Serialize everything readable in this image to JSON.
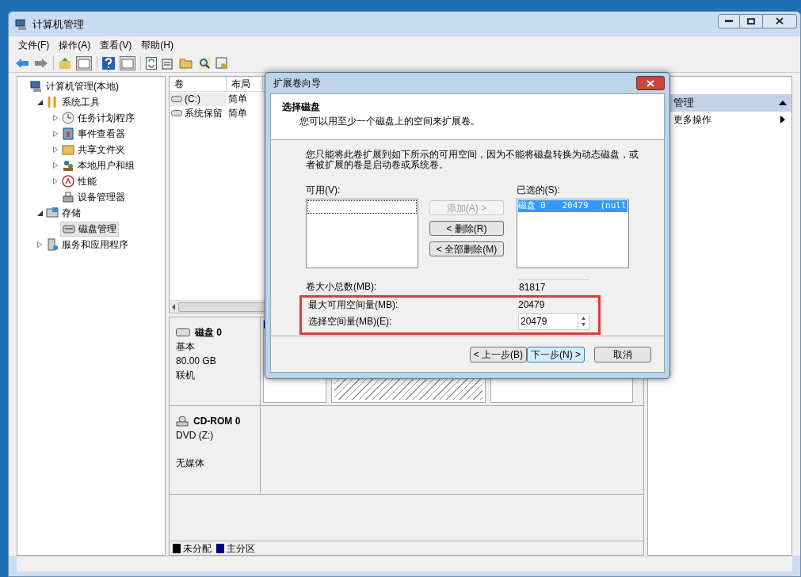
{
  "window": {
    "title": "计算机管理"
  },
  "menu": [
    {
      "label": "文件(F)"
    },
    {
      "label": "操作(A)"
    },
    {
      "label": "查看(V)"
    },
    {
      "label": "帮助(H)"
    }
  ],
  "tree": [
    {
      "label": "计算机管理(本地)",
      "selected": false,
      "children": [
        {
          "label": "系统工具",
          "expanded": true,
          "selected": false,
          "children": [
            {
              "label": "任务计划程序",
              "expanded": false,
              "selected": false
            },
            {
              "label": "事件查看器",
              "expanded": false,
              "selected": false
            },
            {
              "label": "共享文件夹",
              "expanded": false,
              "selected": false
            },
            {
              "label": "本地用户和组",
              "expanded": false,
              "selected": false
            },
            {
              "label": "性能",
              "expanded": false,
              "selected": false
            },
            {
              "label": "设备管理器",
              "selected": false
            }
          ]
        },
        {
          "label": "存储",
          "expanded": true,
          "selected": false,
          "children": [
            {
              "label": "磁盘管理",
              "selected": true
            }
          ]
        },
        {
          "label": "服务和应用程序",
          "expanded": false,
          "selected": false
        }
      ]
    }
  ],
  "volumes": {
    "columns": [
      "卷",
      "布局"
    ],
    "rows": [
      {
        "cells": [
          "(C:)",
          "简单"
        ],
        "selected": true
      },
      {
        "cells": [
          "系统保留",
          "简单"
        ],
        "selected": false
      }
    ]
  },
  "disks": [
    {
      "kind": "disk",
      "name": "磁盘 0",
      "lines": [
        "基本",
        "80.00 GB",
        "联机"
      ],
      "partitions": [
        {
          "kind": "primary",
          "selected": false
        },
        {
          "kind": "primary",
          "selected": true
        },
        {
          "kind": "unallocated",
          "selected": false
        }
      ]
    },
    {
      "kind": "cdrom",
      "name": "CD-ROM 0",
      "lines": [
        "DVD (Z:)",
        "无媒体"
      ]
    }
  ],
  "legend": [
    {
      "label": "未分配",
      "color": "#000000"
    },
    {
      "label": "主分区",
      "color": "#000080"
    }
  ],
  "actions": {
    "header": "管理",
    "items": [
      "更多操作"
    ]
  },
  "dialog": {
    "title": "扩展卷向导",
    "heading": "选择磁盘",
    "subheading": "您可以用至少一个磁盘上的空间来扩展卷。",
    "description": "您只能将此卷扩展到如下所示的可用空间，因为不能将磁盘转换为动态磁盘，或者被扩展的卷是启动卷或系统卷。",
    "available_label": "可用(V):",
    "selected_label": "已选的(S):",
    "selected_items": [
      {
        "cells": [
          "磁盘 0",
          "20479",
          "(null"
        ],
        "selected": true
      }
    ],
    "move_buttons": [
      {
        "label": "添加(A) >",
        "disabled": true
      },
      {
        "label": "< 删除(R)",
        "disabled": false
      },
      {
        "label": "< 全部删除(M)",
        "disabled": false
      }
    ],
    "total_label": "卷大小总数(MB):",
    "total_value": "81817",
    "max_label": "最大可用空间量(MB):",
    "max_value": "20479",
    "select_label": "选择空间量(MB)(E):",
    "select_value": "20479",
    "buttons": [
      {
        "label": "< 上一步(B)",
        "default": false
      },
      {
        "label": "下一步(N) >",
        "default": true
      },
      {
        "label": "取消",
        "default": false
      }
    ]
  }
}
